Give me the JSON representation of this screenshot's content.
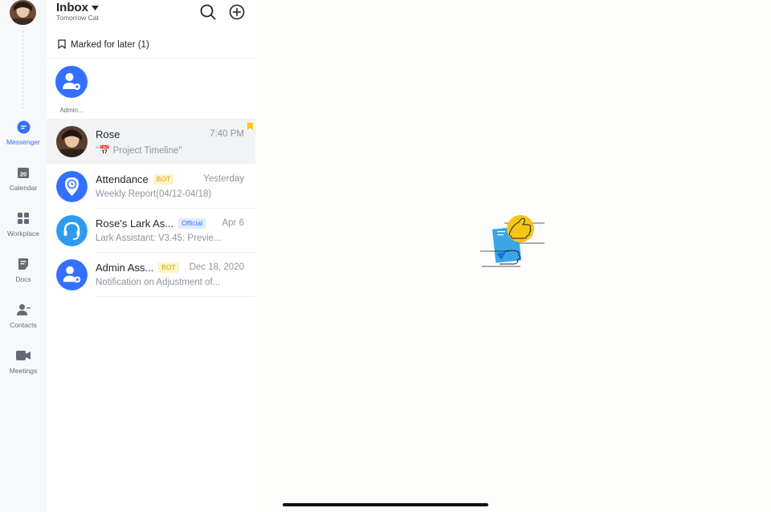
{
  "header": {
    "title": "Inbox",
    "subtitle": "Tomorrow Cat"
  },
  "marked": {
    "label": "Marked for later (1)"
  },
  "pinned": [
    {
      "label": "Admin..."
    }
  ],
  "nav": [
    {
      "label": "Messenger",
      "icon": "messenger-icon",
      "active": true
    },
    {
      "label": "Calendar",
      "icon": "calendar-icon",
      "badge": "20"
    },
    {
      "label": "Workplace",
      "icon": "workplace-icon"
    },
    {
      "label": "Docs",
      "icon": "docs-icon"
    },
    {
      "label": "Contacts",
      "icon": "contacts-icon"
    },
    {
      "label": "Meetings",
      "icon": "meetings-icon"
    }
  ],
  "chats": [
    {
      "name": "Rose",
      "time": "7:40 PM",
      "preview": "\"📅 Project Timeline\"",
      "bookmarked": true,
      "selected": true
    },
    {
      "name": "Attendance",
      "tag": "BOT",
      "time": "Yesterday",
      "preview": "Weekly Report(04/12-04/18)"
    },
    {
      "name": "Rose's Lark As...",
      "tag": "Official",
      "time": "Apr 6",
      "preview": "Lark Assistant: V3.45: Previe..."
    },
    {
      "name": "Admin Ass...",
      "tag": "BOT",
      "time": "Dec 18, 2020",
      "preview": "Notification on Adjustment of..."
    }
  ],
  "colors": {
    "accent": "#3370ff",
    "bot_tag_bg": "#fdf4c8",
    "bot_tag_text": "#d7a400",
    "official_tag_bg": "#e1eaff",
    "bookmark": "#ffc60a"
  }
}
